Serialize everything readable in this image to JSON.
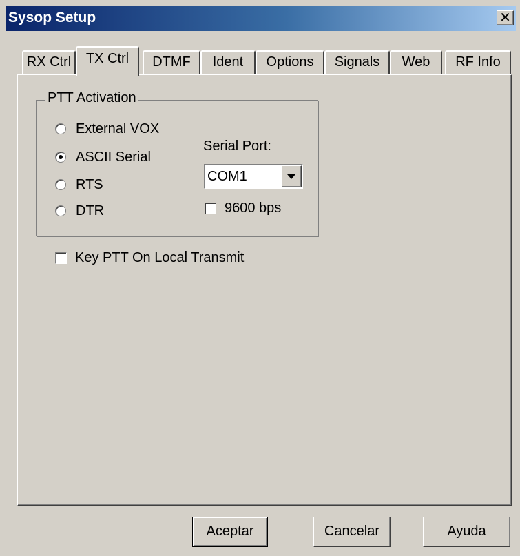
{
  "window": {
    "title": "Sysop Setup",
    "close_glyph": "✕"
  },
  "tabs": [
    {
      "label": "RX Ctrl"
    },
    {
      "label": "TX Ctrl",
      "active": true
    },
    {
      "label": "DTMF"
    },
    {
      "label": "Ident"
    },
    {
      "label": "Options"
    },
    {
      "label": "Signals"
    },
    {
      "label": "Web"
    },
    {
      "label": "RF Info"
    }
  ],
  "ptt_activation": {
    "legend": "PTT Activation",
    "options": [
      {
        "label": "External VOX",
        "selected": false
      },
      {
        "label": "ASCII Serial",
        "selected": true
      },
      {
        "label": "RTS",
        "selected": false
      },
      {
        "label": "DTR",
        "selected": false
      }
    ],
    "serial_port_label": "Serial Port:",
    "serial_port_value": "COM1",
    "baud_label": "9600 bps",
    "baud_checked": false
  },
  "key_ptt_local": {
    "label": "Key PTT On Local Transmit",
    "checked": false
  },
  "buttons": {
    "ok": "Aceptar",
    "cancel": "Cancelar",
    "help": "Ayuda"
  },
  "colors": {
    "face": "#d4d0c8",
    "title_start": "#0a246a",
    "title_end": "#a6caf0"
  }
}
